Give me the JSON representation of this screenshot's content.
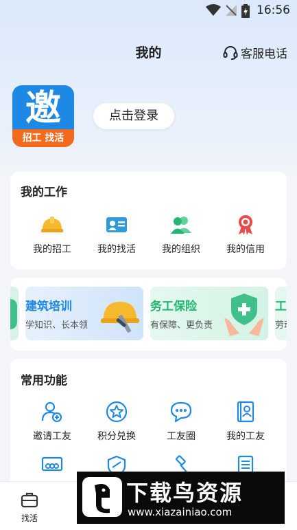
{
  "status_bar": {
    "time": "16:56"
  },
  "header": {
    "title": "我的",
    "service_label": "客服电话"
  },
  "profile": {
    "logo_glyph": "邀",
    "logo_band": "招工 找活",
    "login_label": "点击登录"
  },
  "my_work": {
    "title": "我的工作",
    "items": [
      {
        "label": "我的招工",
        "icon": "hardhat-icon"
      },
      {
        "label": "我的找活",
        "icon": "id-card-icon"
      },
      {
        "label": "我的组织",
        "icon": "group-icon"
      },
      {
        "label": "我的信用",
        "icon": "medal-icon"
      }
    ]
  },
  "banners": [
    {
      "title": "建筑培训",
      "subtitle": "学知识、长本领"
    },
    {
      "title": "务工保险",
      "subtitle": "有保障、更负责"
    },
    {
      "title": "工",
      "subtitle": "劳动"
    }
  ],
  "common": {
    "title": "常用功能",
    "items": [
      {
        "label": "邀请工友",
        "icon": "invite-user-icon"
      },
      {
        "label": "积分兑换",
        "icon": "star-icon"
      },
      {
        "label": "工友圈",
        "icon": "chat-icon"
      },
      {
        "label": "我的工友",
        "icon": "contact-book-icon"
      }
    ],
    "row2_icons": [
      "projector-icon",
      "shield-icon",
      "gavel-icon",
      "document-icon"
    ]
  },
  "bottom_nav": {
    "first_label": "找活"
  },
  "watermark": {
    "title": "下载鸟资源",
    "url": "www.xiazainiao.com"
  },
  "colors": {
    "accent_blue": "#1e88e5",
    "accent_orange": "#f26b1d",
    "green": "#22b573",
    "red": "#e84b4b"
  }
}
